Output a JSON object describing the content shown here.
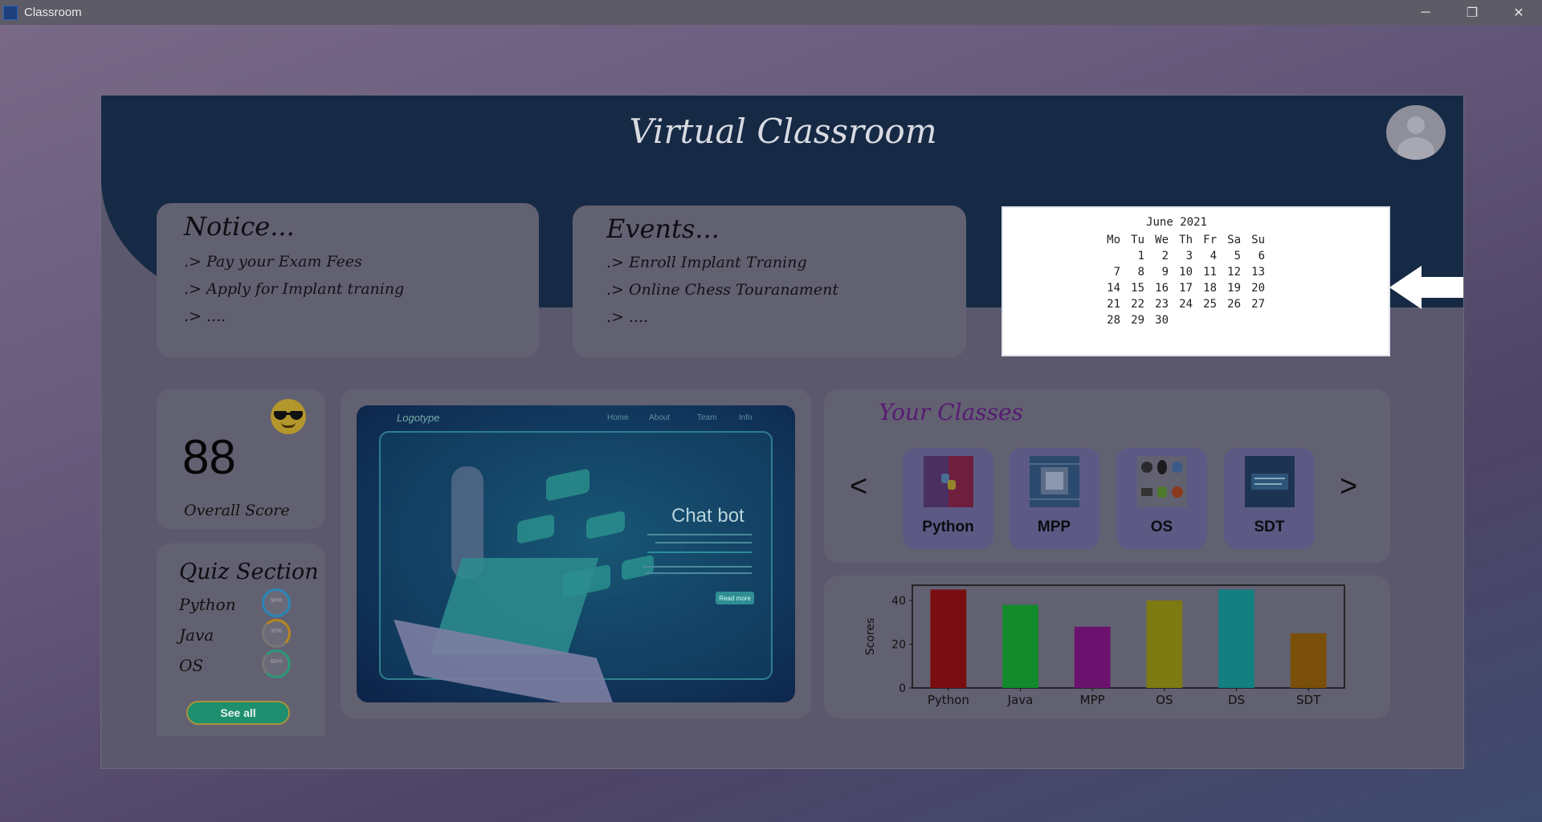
{
  "window": {
    "title": "Classroom",
    "controls": {
      "minimize": "─",
      "maximize": "❐",
      "close": "✕"
    }
  },
  "app": {
    "title": "Virtual Classroom"
  },
  "notice": {
    "title": "Notice...",
    "items": [
      ".> Pay your Exam Fees",
      ".> Apply for Implant traning",
      ".> ...."
    ]
  },
  "events": {
    "title": "Events...",
    "items": [
      ".> Enroll Implant Traning",
      ".> Online Chess Touranament",
      ".> ...."
    ]
  },
  "calendar": {
    "month_label": "June 2021",
    "weekdays": [
      "Mo",
      "Tu",
      "We",
      "Th",
      "Fr",
      "Sa",
      "Su"
    ],
    "weeks": [
      [
        "",
        "1",
        "2",
        "3",
        "4",
        "5",
        "6"
      ],
      [
        "7",
        "8",
        "9",
        "10",
        "11",
        "12",
        "13"
      ],
      [
        "14",
        "15",
        "16",
        "17",
        "18",
        "19",
        "20"
      ],
      [
        "21",
        "22",
        "23",
        "24",
        "25",
        "26",
        "27"
      ],
      [
        "28",
        "29",
        "30",
        "",
        "",
        "",
        ""
      ]
    ]
  },
  "score": {
    "value": "88",
    "label": "Overall Score",
    "emoji": "sunglasses-emoji"
  },
  "quiz": {
    "title": "Quiz Section",
    "items": [
      {
        "name": "Python",
        "percent": "90%",
        "color": "#2a86b8"
      },
      {
        "name": "Java",
        "percent": "30%",
        "color": "#b8851f"
      },
      {
        "name": "OS",
        "percent": "60%",
        "color": "#2a9a78"
      }
    ],
    "see_all": "See all"
  },
  "banner": {
    "logo": "Logotype",
    "nav": [
      "Home",
      "About",
      "Team",
      "Info"
    ],
    "headline": "Chat bot",
    "read_more": "Read more"
  },
  "classes": {
    "title": "Your Classes",
    "prev": "<",
    "next": ">",
    "items": [
      {
        "name": "Python",
        "icon": "python-logo-icon"
      },
      {
        "name": "MPP",
        "icon": "processor-chip-icon"
      },
      {
        "name": "OS",
        "icon": "os-logos-icon"
      },
      {
        "name": "SDT",
        "icon": "software-development-icon"
      }
    ]
  },
  "chart_data": {
    "type": "bar",
    "categories": [
      "Python",
      "Java",
      "MPP",
      "OS",
      "DS",
      "SDT"
    ],
    "values": [
      45,
      38,
      28,
      40,
      45,
      25
    ],
    "colors": [
      "#7a0d12",
      "#138a2c",
      "#6b126e",
      "#7d7a12",
      "#137f80",
      "#7a4f0a"
    ],
    "title": "",
    "xlabel": "",
    "ylabel": "Scores",
    "ylim": [
      0,
      47
    ],
    "yticks": [
      "0",
      "20",
      "40"
    ],
    "grid": false
  }
}
